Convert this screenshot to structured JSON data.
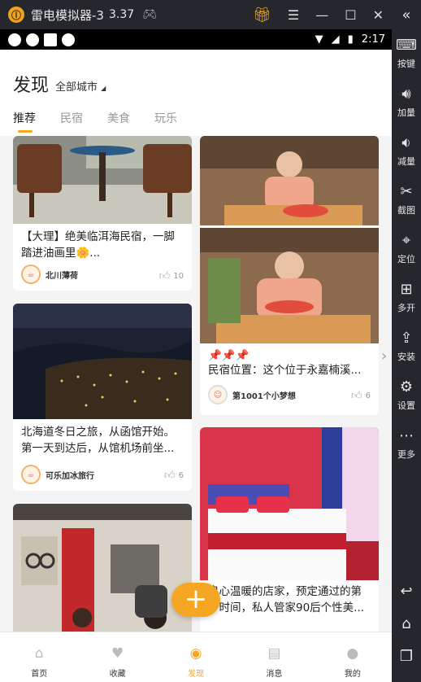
{
  "window": {
    "title": "雷电模拟器-3",
    "version": "3.37"
  },
  "status": {
    "time": "2:17"
  },
  "sidebar": {
    "items": [
      {
        "label": "按键",
        "icon": "keyboard-icon"
      },
      {
        "label": "加量",
        "icon": "volume-up-icon"
      },
      {
        "label": "减量",
        "icon": "volume-down-icon"
      },
      {
        "label": "截图",
        "icon": "scissors-icon"
      },
      {
        "label": "定位",
        "icon": "location-icon"
      },
      {
        "label": "多开",
        "icon": "multi-open-icon"
      },
      {
        "label": "安装",
        "icon": "apk-install-icon"
      },
      {
        "label": "设置",
        "icon": "gear-icon"
      },
      {
        "label": "更多",
        "icon": "more-icon"
      }
    ]
  },
  "header": {
    "title": "发现",
    "city": "全部城市"
  },
  "tabs": [
    {
      "label": "推荐",
      "active": true
    },
    {
      "label": "民宿",
      "active": false
    },
    {
      "label": "美食",
      "active": false
    },
    {
      "label": "玩乐",
      "active": false
    }
  ],
  "cards": [
    {
      "title": "【大理】绝美临洱海民宿，一脚踏进油画里🌼...",
      "author": "北川薄荷",
      "likes": "10"
    },
    {
      "title": "北海道冬日之旅，从函馆开始。第一天到达后，从馆机场前坐...",
      "author": "可乐加冰旅行",
      "likes": "6"
    },
    {
      "title": "📌📌📌",
      "subtitle": "民宿位置：这个位于永嘉楠溪...",
      "author": "第1001个小梦想",
      "likes": "6"
    },
    {
      "title": "良心温暖的店家，预定通过的第一时间，私人管家90后个性美..."
    }
  ],
  "fab": {
    "label": "+"
  },
  "bottom_nav": [
    {
      "label": "首页",
      "icon": "home-icon",
      "active": false
    },
    {
      "label": "收藏",
      "icon": "heart-icon",
      "active": false
    },
    {
      "label": "发现",
      "icon": "compass-icon",
      "active": true
    },
    {
      "label": "消息",
      "icon": "message-icon",
      "active": false
    },
    {
      "label": "我的",
      "icon": "user-icon",
      "active": false
    }
  ],
  "colors": {
    "accent": "#f5a623",
    "emulator_chrome": "#25272c"
  }
}
